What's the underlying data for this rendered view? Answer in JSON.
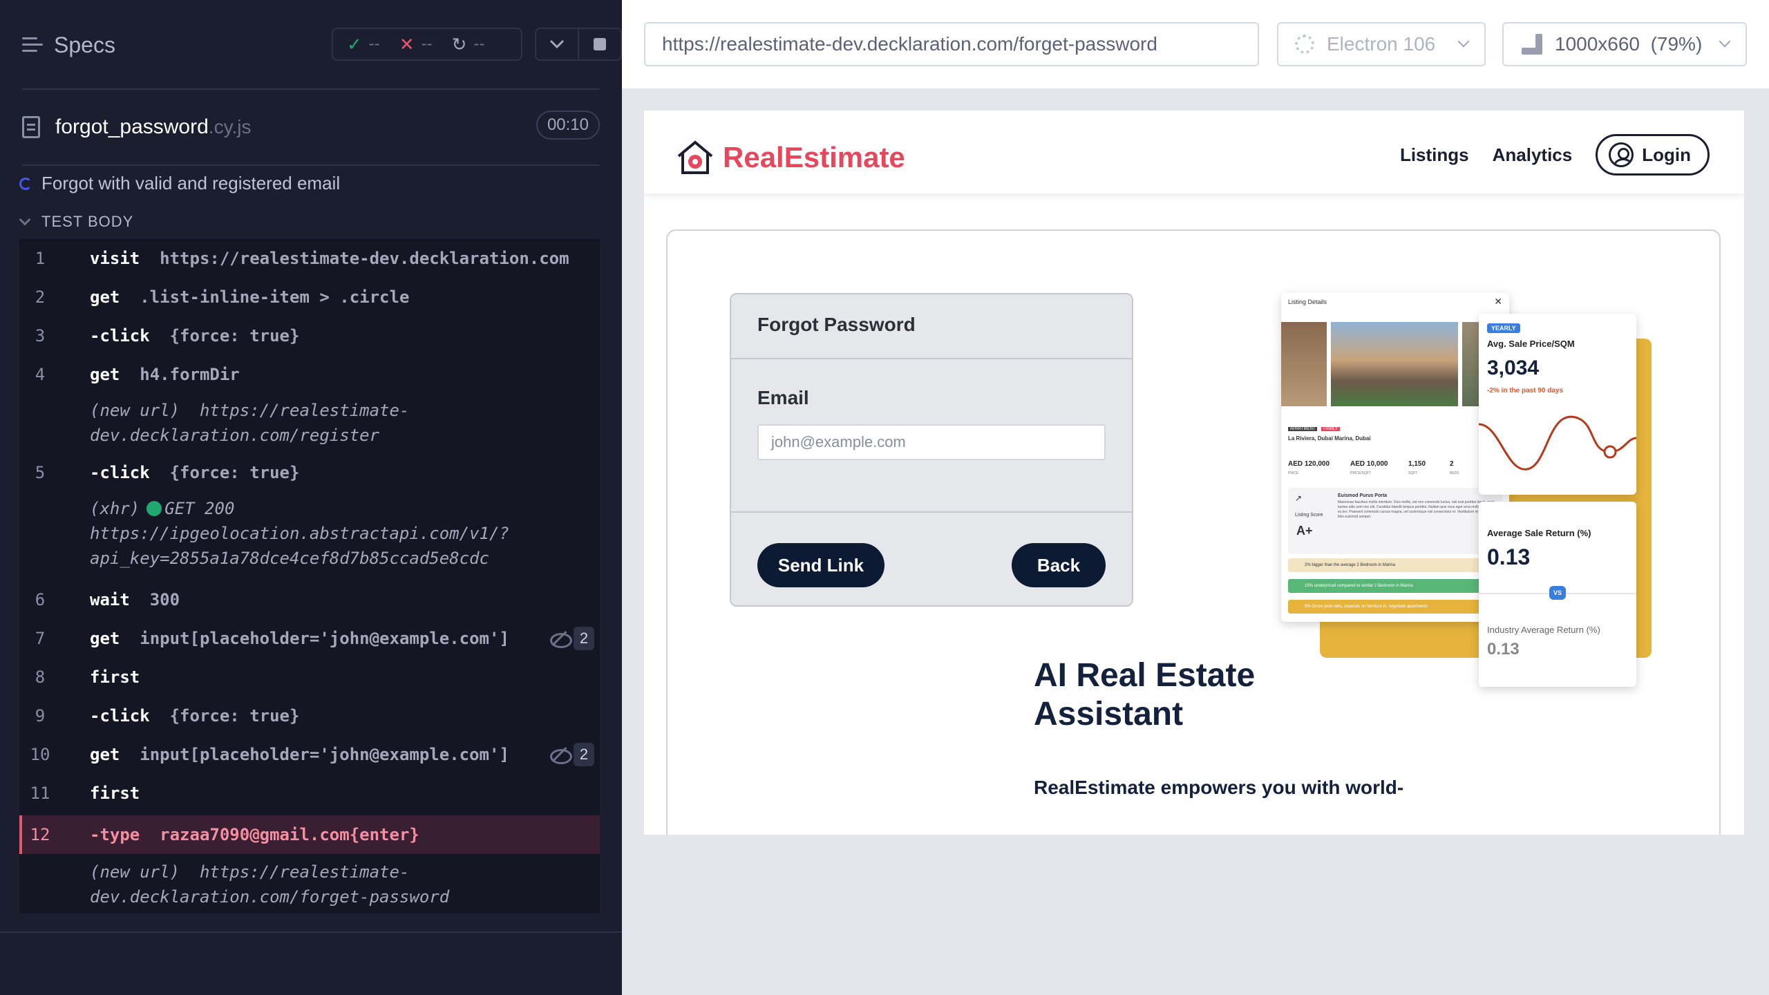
{
  "reporter": {
    "header_title": "Specs",
    "stats": {
      "passed": "--",
      "failed": "--",
      "pending": "--"
    },
    "spec": {
      "name": "forgot_password",
      "ext": ".cy.js",
      "duration": "00:10"
    },
    "test_title": "Forgot with valid and registered email",
    "section_label": "TEST BODY",
    "commands": [
      {
        "num": "1",
        "name": "visit",
        "msg": "https://realestimate-dev.decklaration.com"
      },
      {
        "num": "2",
        "name": "get",
        "msg": ".list-inline-item > .circle"
      },
      {
        "num": "3",
        "name": "-click",
        "msg": "{force: true}"
      },
      {
        "num": "4",
        "name": "get",
        "msg": "h4.formDir"
      },
      {
        "num": "",
        "log_label": "(new url)",
        "log_line1": "https://realestimate-",
        "log_line2": "dev.decklaration.com/register"
      },
      {
        "num": "5",
        "name": "-click",
        "msg": "{force: true}"
      },
      {
        "num": "",
        "log_label": "(xhr)",
        "log_status": "GET 200",
        "log_line1": "https://ipgeolocation.abstractapi.com/v1/?",
        "log_line2": "api_key=2855a1a78dce4cef8d7b85ccad5e8cdc"
      },
      {
        "num": "6",
        "name": "wait",
        "msg": "300"
      },
      {
        "num": "7",
        "name": "get",
        "msg": "input[placeholder='john@example.com']",
        "badge": "2"
      },
      {
        "num": "8",
        "name": "first",
        "msg": ""
      },
      {
        "num": "9",
        "name": "-click",
        "msg": "{force: true}"
      },
      {
        "num": "10",
        "name": "get",
        "msg": "input[placeholder='john@example.com']",
        "badge": "2"
      },
      {
        "num": "11",
        "name": "first",
        "msg": ""
      },
      {
        "num": "12",
        "name": "-type",
        "msg": "razaa7090@gmail.com{enter}"
      },
      {
        "num": "",
        "log_label": "(new url)",
        "log_line1": "https://realestimate-",
        "log_line2": "dev.decklaration.com/forget-password"
      }
    ]
  },
  "aut": {
    "url": "https://realestimate-dev.decklaration.com/forget-password",
    "browser": "Electron 106",
    "viewport": "1000x660",
    "zoom": "(79%)",
    "site": {
      "logo": "RealEstimate",
      "nav": [
        "Listings",
        "Analytics"
      ],
      "login": "Login",
      "form_title": "Forgot Password",
      "email_label": "Email",
      "email_placeholder": "john@example.com",
      "send_button": "Send Link",
      "back_button": "Back",
      "headline_line1": "AI Real Estate",
      "headline_line2": "Assistant",
      "subline": "RealEstimate empowers you with world-"
    },
    "dashboard": {
      "listing_title": "Listing Details",
      "listing_location": "La Riviera, Dubai Marina, Dubai",
      "tag1": "APARTMENT",
      "tag2": "FAMILY",
      "price": "AED 120,000",
      "price_sqft": "AED 10,000",
      "sqft": "1,150",
      "beds": "2",
      "price_lbl": "PRICE",
      "price_sqft_lbl": "PRICE/SQFT",
      "sqft_lbl": "SQFT",
      "beds_lbl": "BEDS",
      "score_label": "Listing Score",
      "score": "A+",
      "score_heading": "Euismod Purus Porta",
      "score_text": "Maecenas faucibus mollis interdum. Duis mollis, est non commodo luctus, nisi erat porttitor ligula, eget lacinia odio sem nec elit. Curabitur blandit tempus porttitor. Nullam quis risus eget urna mollis ornare vel eu leo. Praesent commodo cursus magna, vel scelerisque nisl consectetur et. Vestibulum id ligula porta felis euismod semper.",
      "band1": "2% bigger than the average 2 Bedroom in Marina",
      "band2": "15% underpriced compared to similar 2 Bedroom in Marina",
      "band3": "5% Gross yield ratio, depends on furniture in, negotiate apartments",
      "yearly": "YEARLY",
      "avg_price_label": "Avg. Sale Price/SQM",
      "avg_price": "3,034",
      "avg_price_change": "-2% in the past 90 days",
      "avg_return_label": "Average Sale Return (%)",
      "avg_return": "0.13",
      "vs": "VS",
      "industry_label": "Industry Average Return (%)",
      "industry_value": "0.13"
    }
  }
}
